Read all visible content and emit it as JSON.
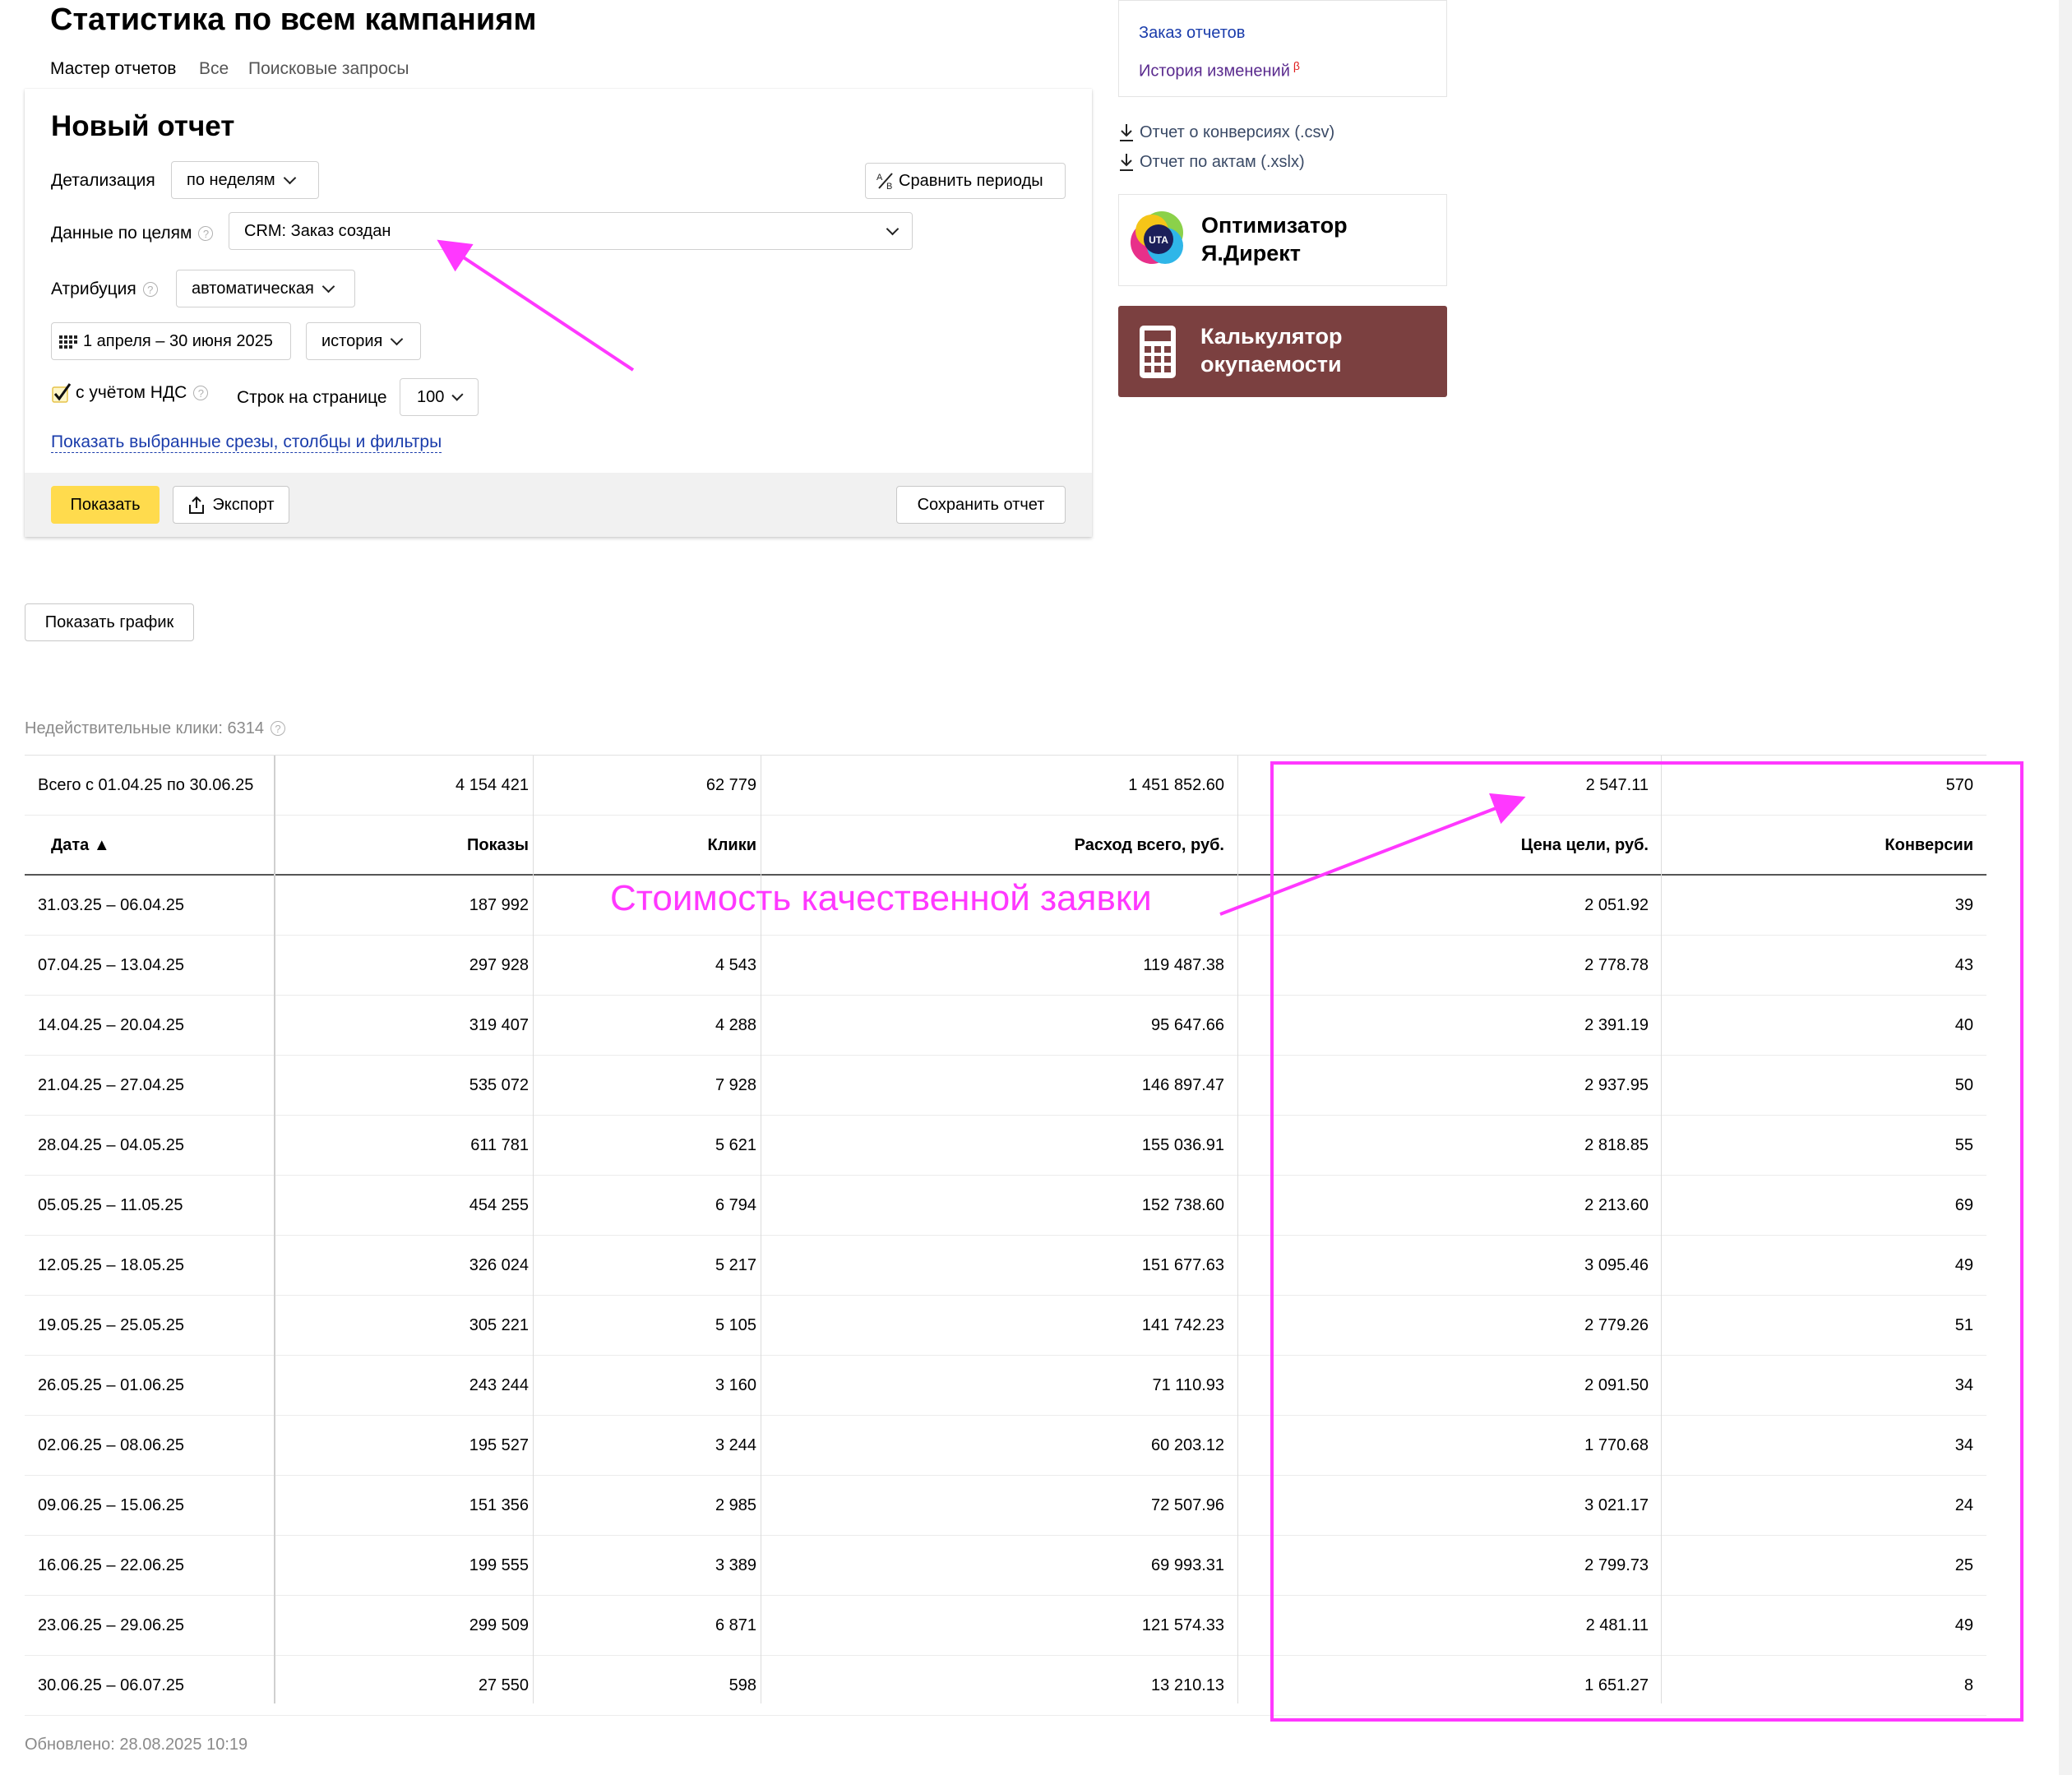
{
  "page": {
    "title": "Статистика по всем кампаниям",
    "tabs": [
      {
        "label": "Мастер отчетов",
        "active": true
      },
      {
        "label": "Все",
        "active": false
      },
      {
        "label": "Поисковые запросы",
        "active": false
      }
    ]
  },
  "report": {
    "title": "Новый отчет",
    "detail_label": "Детализация",
    "detail_value": "по неделям",
    "compare_label": "Сравнить периоды",
    "goals_label": "Данные по целям",
    "goals_value": "CRM: Заказ создан",
    "attribution_label": "Атрибуция",
    "attribution_value": "автоматическая",
    "date_range": "1 апреля – 30 июня 2025",
    "history_value": "история",
    "vat_label": "с учётом НДС",
    "vat_checked": true,
    "rows_label": "Строк на странице",
    "rows_value": "100",
    "show_filters_link": "Показать выбранные срезы, столбцы и фильтры",
    "show_button": "Показать",
    "export_button": "Экспорт",
    "save_button": "Сохранить отчет"
  },
  "sidebar": {
    "order_reports": "Заказ отчетов",
    "history": "История изменений",
    "history_badge": "β",
    "downloads": [
      "Отчет о конверсиях (.csv)",
      "Отчет по актам (.xslx)"
    ],
    "optimizer": {
      "line1": "Оптимизатор",
      "line2": "Я.Директ",
      "logo_text": "UTA"
    },
    "calculator": {
      "line1": "Калькулятор",
      "line2": "окупаемости",
      "bg_color": "#7b4040"
    }
  },
  "chart_button": "Показать график",
  "invalid_clicks": "Недействительные клики: 6314",
  "table": {
    "totals": {
      "label": "Всего с 01.04.25 по 30.06.25",
      "impressions": "4 154 421",
      "clicks": "62 779",
      "spend": "1 451 852.60",
      "goal_cost": "2 547.11",
      "conversions": "570"
    },
    "headers": {
      "date": "Дата ▲",
      "impressions": "Показы",
      "clicks": "Клики",
      "spend": "Расход всего, руб.",
      "goal_cost": "Цена цели, руб.",
      "conversions": "Конверсии"
    },
    "rows": [
      {
        "date": "31.03.25 – 06.04.25",
        "impressions": "187 992",
        "clicks": "",
        "spend": "",
        "goal_cost": "2 051.92",
        "conversions": "39"
      },
      {
        "date": "07.04.25 – 13.04.25",
        "impressions": "297 928",
        "clicks": "4 543",
        "spend": "119 487.38",
        "goal_cost": "2 778.78",
        "conversions": "43"
      },
      {
        "date": "14.04.25 – 20.04.25",
        "impressions": "319 407",
        "clicks": "4 288",
        "spend": "95 647.66",
        "goal_cost": "2 391.19",
        "conversions": "40"
      },
      {
        "date": "21.04.25 – 27.04.25",
        "impressions": "535 072",
        "clicks": "7 928",
        "spend": "146 897.47",
        "goal_cost": "2 937.95",
        "conversions": "50"
      },
      {
        "date": "28.04.25 – 04.05.25",
        "impressions": "611 781",
        "clicks": "5 621",
        "spend": "155 036.91",
        "goal_cost": "2 818.85",
        "conversions": "55"
      },
      {
        "date": "05.05.25 – 11.05.25",
        "impressions": "454 255",
        "clicks": "6 794",
        "spend": "152 738.60",
        "goal_cost": "2 213.60",
        "conversions": "69"
      },
      {
        "date": "12.05.25 – 18.05.25",
        "impressions": "326 024",
        "clicks": "5 217",
        "spend": "151 677.63",
        "goal_cost": "3 095.46",
        "conversions": "49"
      },
      {
        "date": "19.05.25 – 25.05.25",
        "impressions": "305 221",
        "clicks": "5 105",
        "spend": "141 742.23",
        "goal_cost": "2 779.26",
        "conversions": "51"
      },
      {
        "date": "26.05.25 – 01.06.25",
        "impressions": "243 244",
        "clicks": "3 160",
        "spend": "71 110.93",
        "goal_cost": "2 091.50",
        "conversions": "34"
      },
      {
        "date": "02.06.25 – 08.06.25",
        "impressions": "195 527",
        "clicks": "3 244",
        "spend": "60 203.12",
        "goal_cost": "1 770.68",
        "conversions": "34"
      },
      {
        "date": "09.06.25 – 15.06.25",
        "impressions": "151 356",
        "clicks": "2 985",
        "spend": "72 507.96",
        "goal_cost": "3 021.17",
        "conversions": "24"
      },
      {
        "date": "16.06.25 – 22.06.25",
        "impressions": "199 555",
        "clicks": "3 389",
        "spend": "69 993.31",
        "goal_cost": "2 799.73",
        "conversions": "25"
      },
      {
        "date": "23.06.25 – 29.06.25",
        "impressions": "299 509",
        "clicks": "6 871",
        "spend": "121 574.33",
        "goal_cost": "2 481.11",
        "conversions": "49"
      },
      {
        "date": "30.06.25 – 06.07.25",
        "impressions": "27 550",
        "clicks": "598",
        "spend": "13 210.13",
        "goal_cost": "1 651.27",
        "conversions": "8"
      }
    ]
  },
  "updated": "Обновлено: 28.08.2025 10:19",
  "annotation": {
    "text": "Стоимость качественной заявки",
    "color": "#ff38ff"
  },
  "colors": {
    "accent_red": "#e02020",
    "button_yellow": "#ffdb4d",
    "link_blue": "#1a3cab"
  }
}
